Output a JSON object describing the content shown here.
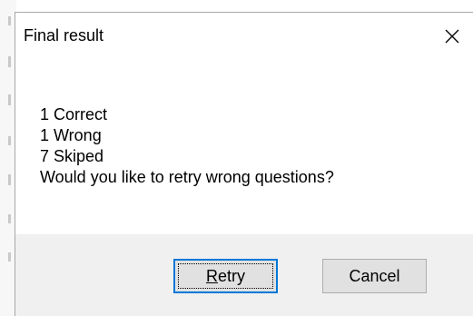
{
  "dialog": {
    "title": "Final result",
    "close_icon": "close-icon",
    "message_lines": [
      "1 Correct",
      "1 Wrong",
      "7 Skiped",
      "Would you like to retry wrong questions?"
    ],
    "buttons": {
      "retry": {
        "accelerator": "R",
        "rest": "etry",
        "default": true
      },
      "cancel": {
        "label": "Cancel"
      }
    }
  },
  "colors": {
    "content_background": "#ffffff",
    "footer_background": "#f0f0f0",
    "button_face": "#e1e1e1",
    "default_button_border": "#0078d7"
  }
}
